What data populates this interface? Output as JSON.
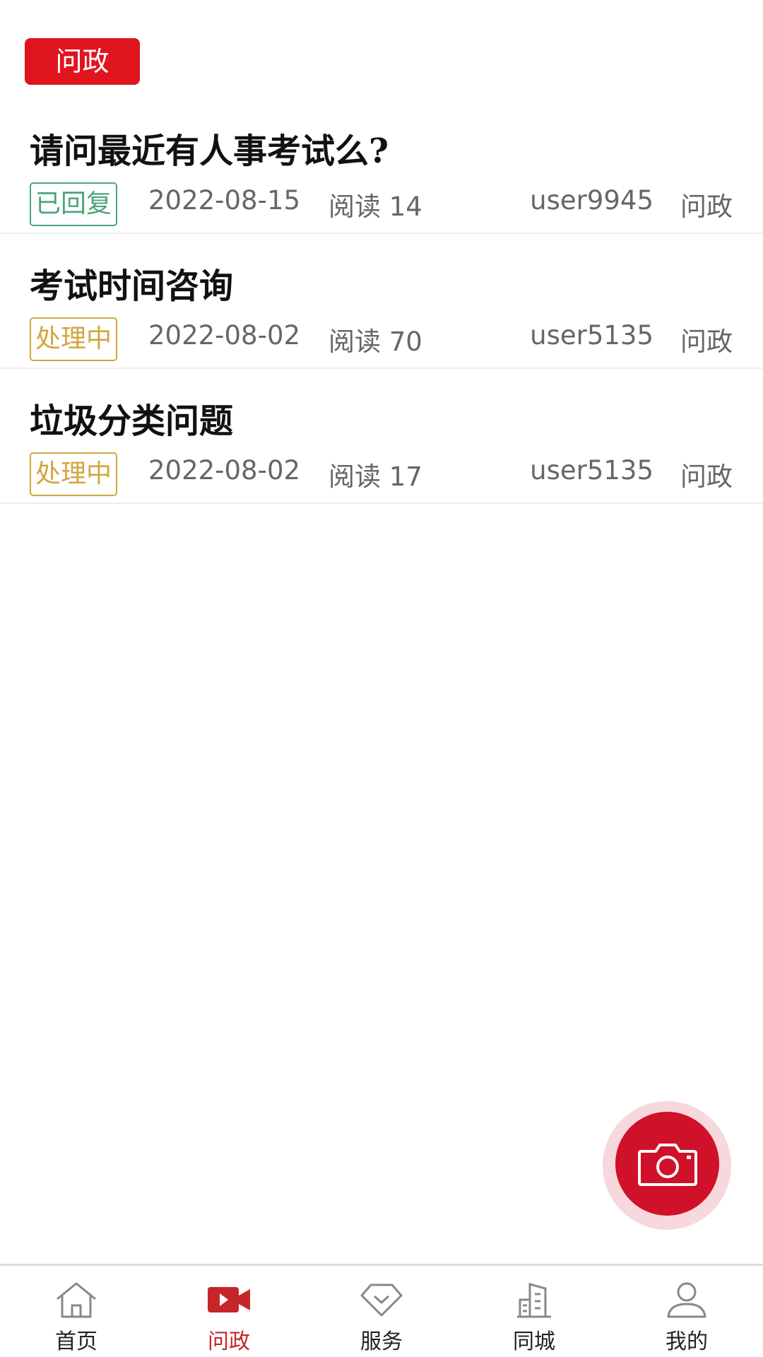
{
  "header": {
    "category_tag": "问政"
  },
  "posts": [
    {
      "title": "请问最近有人事考试么?",
      "status": "已回复",
      "status_type": "replied",
      "date": "2022-08-15",
      "reads": "阅读 14",
      "user": "user9945",
      "category": "问政"
    },
    {
      "title": "考试时间咨询",
      "status": "处理中",
      "status_type": "processing",
      "date": "2022-08-02",
      "reads": "阅读 70",
      "user": "user5135",
      "category": "问政"
    },
    {
      "title": "垃圾分类问题",
      "status": "处理中",
      "status_type": "processing",
      "date": "2022-08-02",
      "reads": "阅读 17",
      "user": "user5135",
      "category": "问政"
    }
  ],
  "fab": {
    "icon": "camera-icon"
  },
  "tabbar": {
    "tabs": [
      {
        "label": "首页",
        "icon": "home-icon",
        "active": false
      },
      {
        "label": "问政",
        "icon": "video-icon",
        "active": true
      },
      {
        "label": "服务",
        "icon": "service-icon",
        "active": false
      },
      {
        "label": "同城",
        "icon": "city-icon",
        "active": false
      },
      {
        "label": "我的",
        "icon": "user-icon",
        "active": false
      }
    ]
  },
  "colors": {
    "accent": "#e0151f",
    "fab": "#cf1129",
    "replied": "#4aa676",
    "processing": "#d1a63d",
    "active_tab": "#c6262a"
  }
}
